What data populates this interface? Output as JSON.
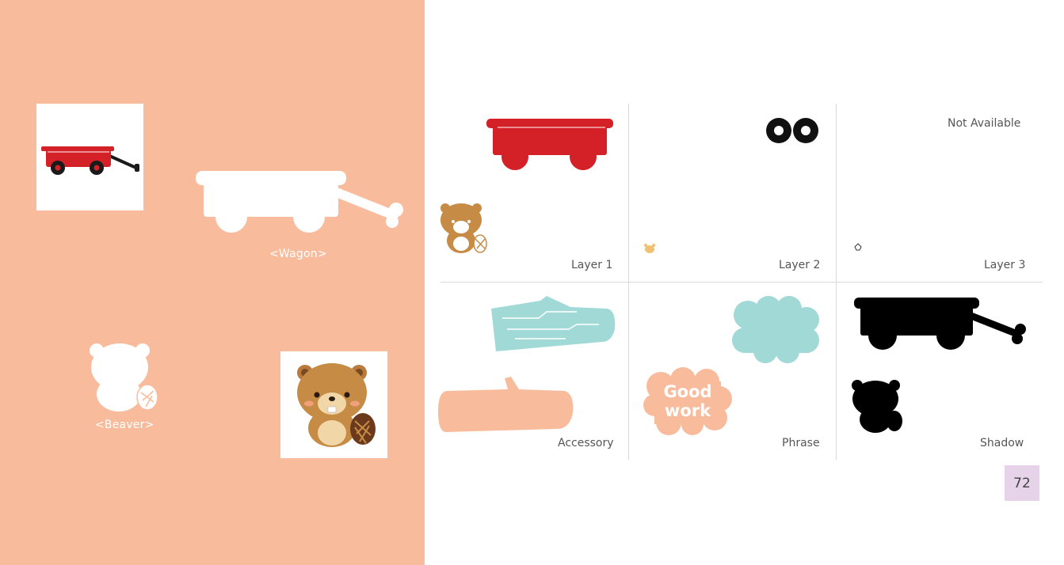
{
  "left_panel": {
    "wagon_caption": "<Wagon>",
    "beaver_caption": "<Beaver>"
  },
  "grid": {
    "cells": [
      {
        "label": "Layer 1"
      },
      {
        "label": "Layer 2"
      },
      {
        "label": "Layer 3",
        "note": "Not Available"
      },
      {
        "label": "Accessory"
      },
      {
        "label": "Phrase",
        "phrase_art_text": "Good work"
      },
      {
        "label": "Shadow"
      }
    ]
  },
  "page_number": "72",
  "colors": {
    "background_left": "#f8bc9c",
    "wagon_red": "#d42027",
    "beaver_brown": "#c68b45",
    "aqua": "#a0d9d6",
    "peach": "#f8bc9c",
    "page_badge": "#e6d3ea"
  }
}
